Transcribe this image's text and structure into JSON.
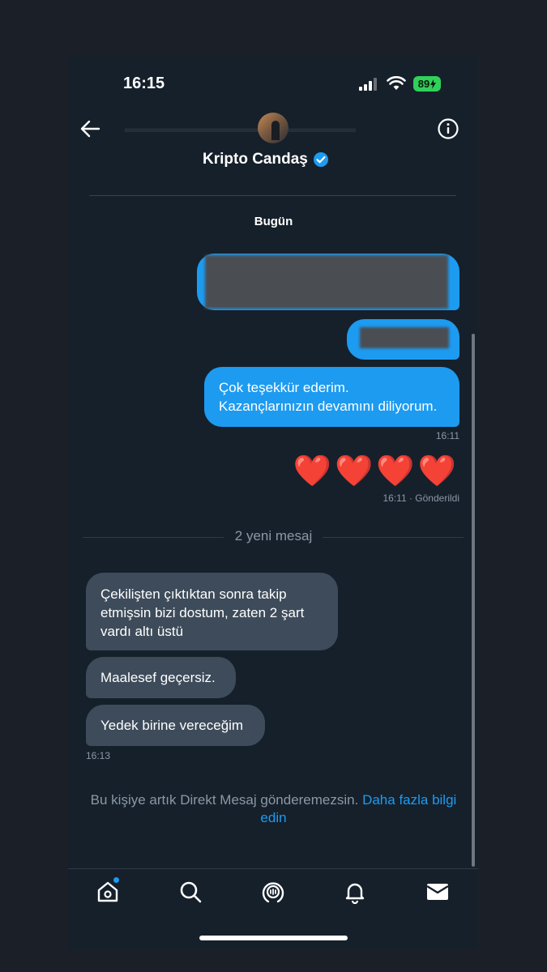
{
  "status_bar": {
    "time": "16:15",
    "battery": "89"
  },
  "header": {
    "name": "Kripto Candaş",
    "verified_badge_color": "#1d9bf0"
  },
  "conversation": {
    "day_label": "Bugün",
    "sent_message": {
      "line1": "Çok teşekkür ederim.",
      "line2": "Kazançlarınızın devamını diliyorum.",
      "time": "16:11"
    },
    "reaction": {
      "hearts": "❤️❤️❤️❤️",
      "status": "16:11 · Gönderildi"
    },
    "new_messages_label": "2 yeni mesaj",
    "received": [
      {
        "line1": "Çekilişten çıktıktan sonra takip",
        "line2": "etmişsin bizi dostum, zaten 2  şart",
        "line3": "vardı altı üstü"
      },
      {
        "text": "Maalesef geçersiz."
      },
      {
        "text": "Yedek birine vereceğim"
      }
    ],
    "received_time": "16:13"
  },
  "footer_notice": {
    "text": "Bu kişiye artık Direkt Mesaj gönderemezsin.",
    "link_part1": "Daha fazla bilgi",
    "link_part2": "edin"
  },
  "tabbar": {
    "items": [
      "home-icon",
      "search-icon",
      "spaces-icon",
      "notifications-icon",
      "messages-icon"
    ]
  }
}
